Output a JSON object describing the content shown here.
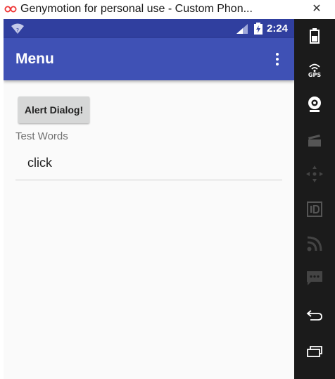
{
  "window": {
    "title": "Genymotion for personal use - Custom Phon...",
    "close_glyph": "✕"
  },
  "statusbar": {
    "time": "2:24",
    "icons": [
      "wifi-icon",
      "signal-icon",
      "battery-charging-icon"
    ]
  },
  "appbar": {
    "title": "Menu",
    "overflow_icon": "more-vert-icon"
  },
  "content": {
    "alert_button_label": "Alert Dialog!",
    "field_label": "Test Words",
    "field_value": "click"
  },
  "panel": {
    "gps_label": "GPS",
    "controls": [
      "battery-icon",
      "gps-icon",
      "webcam-icon",
      "capture-icon",
      "dpad-icon",
      "id-icon",
      "rss-icon",
      "sms-icon",
      "back-icon",
      "recent-apps-icon"
    ]
  },
  "colors": {
    "primary": "#3f51b5",
    "primary_dark": "#303f9f",
    "background": "#fafafa",
    "panel": "#1b1b1b"
  }
}
